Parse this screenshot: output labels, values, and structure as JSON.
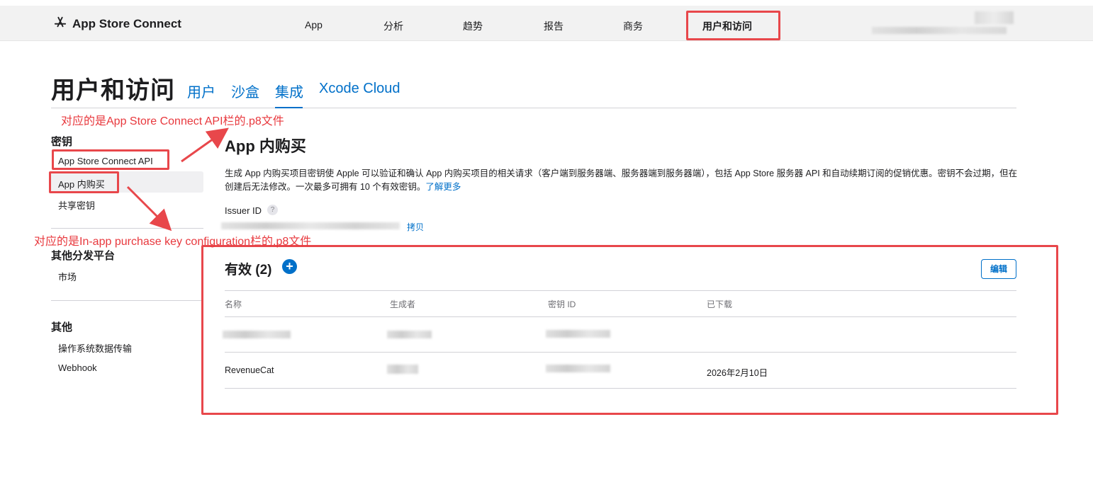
{
  "brand": {
    "name": "App Store Connect",
    "icon": "app-store-icon"
  },
  "nav": {
    "items": [
      "App",
      "分析",
      "趋势",
      "报告",
      "商务",
      "用户和访问"
    ],
    "active": "用户和访问"
  },
  "header": {
    "title": "用户和访问",
    "tabs": [
      "用户",
      "沙盒",
      "集成",
      "Xcode Cloud"
    ],
    "active_tab": "集成"
  },
  "sidebar": {
    "sections": [
      {
        "heading": "密钥",
        "items": [
          "App Store Connect API",
          "App 内购买",
          "共享密钥"
        ]
      },
      {
        "heading": "其他分发平台",
        "items": [
          "市场"
        ]
      },
      {
        "heading": "其他",
        "items": [
          "操作系统数据传输",
          "Webhook"
        ]
      }
    ],
    "selected": "App 内购买"
  },
  "main": {
    "title": "App 内购买",
    "description": "生成 App 内购买项目密钥使 Apple 可以验证和确认 App 内购买项目的相关请求（客户端到服务器端、服务器端到服务器端），包括 App Store 服务器 API 和自动续期订阅的促销优惠。密钥不会过期，但在创建后无法修改。一次最多可拥有 10 个有效密钥。",
    "learn_more": "了解更多",
    "issuer_label": "Issuer ID",
    "help_icon": "question-icon",
    "copy_label": "拷贝",
    "active_heading": "有效 (2)",
    "add_icon": "plus-circle-icon",
    "edit_label": "编辑",
    "table": {
      "columns": [
        "名称",
        "生成者",
        "密钥 ID",
        "已下载"
      ],
      "rows": [
        [
          "",
          "",
          "",
          ""
        ],
        [
          "RevenueCat",
          "",
          "",
          "2026年2月10日"
        ]
      ]
    }
  },
  "annotations": {
    "note_api": "对应的是App Store Connect API栏的.p8文件",
    "note_iap": "对应的是In-app purchase key configuration栏的.p8文件",
    "color": "#e8474b"
  },
  "colors": {
    "accent": "#0070c9",
    "topbar": "#f2f2f2",
    "annotation": "#e8474b"
  }
}
